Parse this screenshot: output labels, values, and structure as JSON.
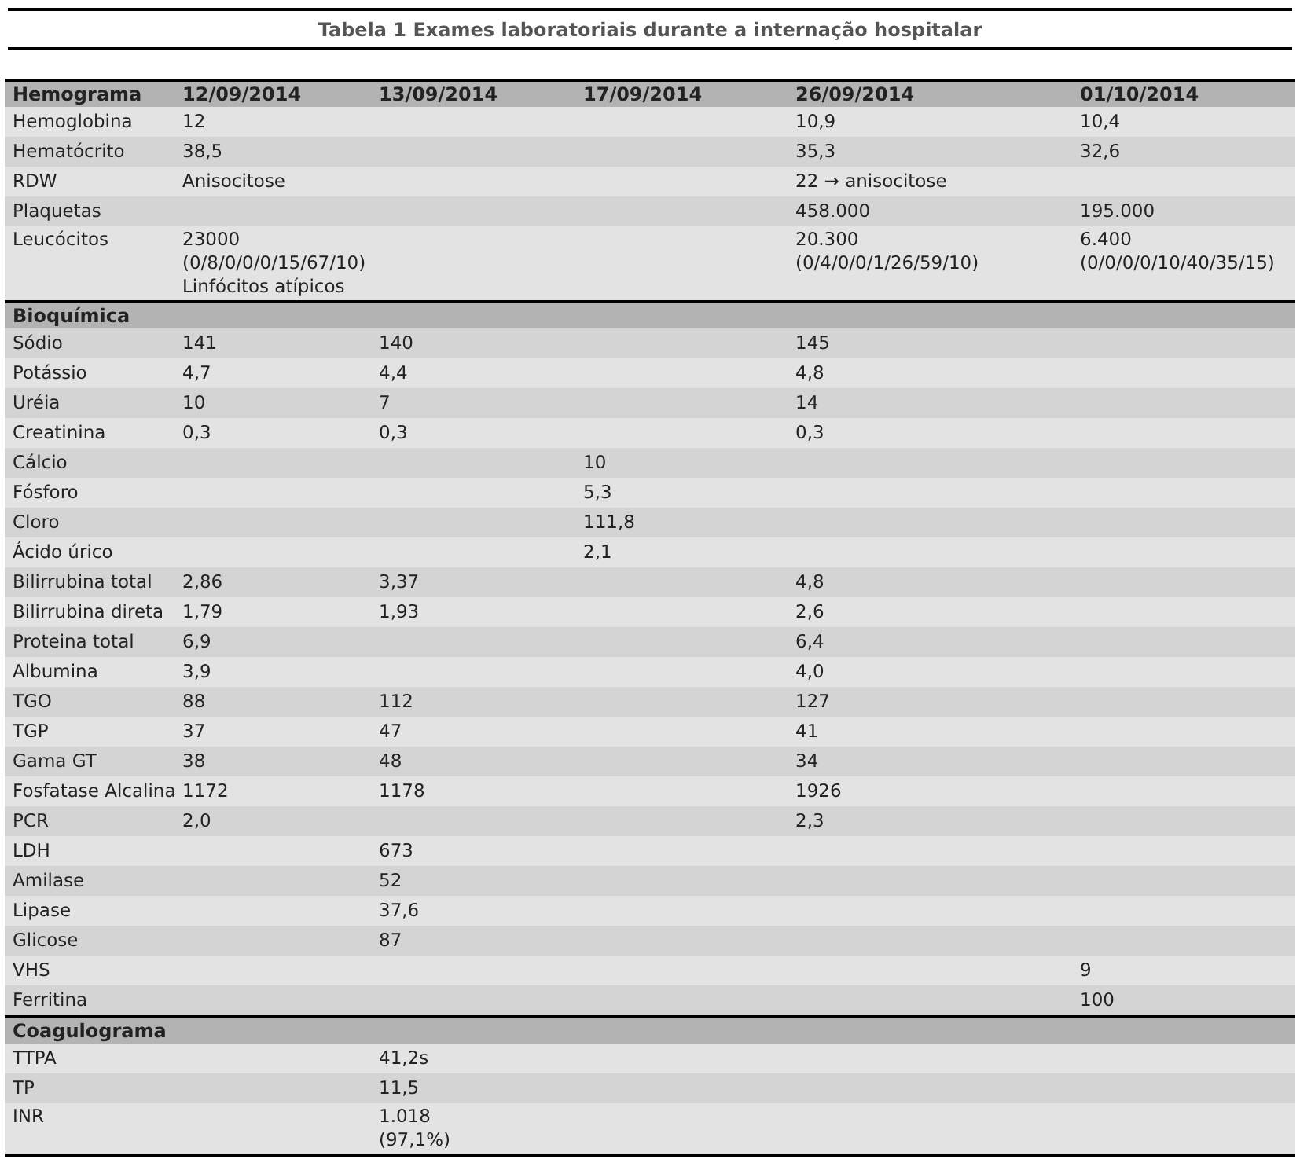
{
  "title": "Tabela 1  Exames laboratoriais durante a internação hospitalar",
  "sections": [
    {
      "title": "Hemograma",
      "columns": [
        "12/09/2014",
        "13/09/2014",
        "17/09/2014",
        "26/09/2014",
        "01/10/2014"
      ],
      "rows": [
        {
          "label": "Hemoglobina",
          "cells": [
            "12",
            null,
            null,
            "10,9",
            "10,4"
          ]
        },
        {
          "label": "Hematócrito",
          "cells": [
            "38,5",
            null,
            null,
            "35,3",
            "32,6"
          ]
        },
        {
          "label": "RDW",
          "cells": [
            "Anisocitose",
            null,
            null,
            "22 → anisocitose",
            null
          ]
        },
        {
          "label": "Plaquetas",
          "cells": [
            null,
            null,
            null,
            "458.000",
            "195.000"
          ]
        },
        {
          "label": "Leucócitos",
          "cells": [
            "23000\n(0/8/0/0/0/15/67/10)\nLinfócitos atípicos",
            null,
            null,
            "20.300\n(0/4/0/0/1/26/59/10)",
            "6.400\n(0/0/0/0/10/40/35/15)"
          ]
        }
      ]
    },
    {
      "title": "Bioquímica",
      "rows": [
        {
          "label": "Sódio",
          "cells": [
            "141",
            "140",
            null,
            "145",
            null
          ]
        },
        {
          "label": "Potássio",
          "cells": [
            "4,7",
            "4,4",
            null,
            "4,8",
            null
          ]
        },
        {
          "label": "Uréia",
          "cells": [
            "10",
            "7",
            null,
            "14",
            null
          ]
        },
        {
          "label": "Creatinina",
          "cells": [
            "0,3",
            "0,3",
            null,
            "0,3",
            null
          ]
        },
        {
          "label": "Cálcio",
          "cells": [
            null,
            null,
            "10",
            null,
            null
          ]
        },
        {
          "label": "Fósforo",
          "cells": [
            null,
            null,
            "5,3",
            null,
            null
          ]
        },
        {
          "label": "Cloro",
          "cells": [
            null,
            null,
            "111,8",
            null,
            null
          ]
        },
        {
          "label": "Ácido úrico",
          "cells": [
            null,
            null,
            "2,1",
            null,
            null
          ]
        },
        {
          "label": "Bilirrubina total",
          "cells": [
            "2,86",
            "3,37",
            null,
            "4,8",
            null
          ]
        },
        {
          "label": "Bilirrubina direta",
          "cells": [
            "1,79",
            "1,93",
            null,
            "2,6",
            null
          ]
        },
        {
          "label": "Proteina total",
          "cells": [
            "6,9",
            null,
            null,
            "6,4",
            null
          ]
        },
        {
          "label": "Albumina",
          "cells": [
            "3,9",
            null,
            null,
            "4,0",
            null
          ]
        },
        {
          "label": "TGO",
          "cells": [
            "88",
            "112",
            null,
            "127",
            null
          ]
        },
        {
          "label": "TGP",
          "cells": [
            "37",
            "47",
            null,
            "41",
            null
          ]
        },
        {
          "label": "Gama GT",
          "cells": [
            "38",
            "48",
            null,
            "34",
            null
          ]
        },
        {
          "label": "Fosfatase Alcalina",
          "cells": [
            "1172",
            "1178",
            null,
            "1926",
            null
          ]
        },
        {
          "label": "PCR",
          "cells": [
            "2,0",
            null,
            null,
            "2,3",
            null
          ]
        },
        {
          "label": "LDH",
          "cells": [
            null,
            "673",
            null,
            null,
            null
          ]
        },
        {
          "label": "Amilase",
          "cells": [
            null,
            "52",
            null,
            null,
            null
          ]
        },
        {
          "label": "Lipase",
          "cells": [
            null,
            "37,6",
            null,
            null,
            null
          ]
        },
        {
          "label": "Glicose",
          "cells": [
            null,
            "87",
            null,
            null,
            null
          ]
        },
        {
          "label": "VHS",
          "cells": [
            null,
            null,
            null,
            null,
            "9"
          ]
        },
        {
          "label": "Ferritina",
          "cells": [
            null,
            null,
            null,
            null,
            "100"
          ]
        }
      ]
    },
    {
      "title": "Coagulograma",
      "rows": [
        {
          "label": "TTPA",
          "cells": [
            null,
            "41,2s",
            null,
            null,
            null
          ]
        },
        {
          "label": "TP",
          "cells": [
            null,
            "11,5",
            null,
            null,
            null
          ]
        },
        {
          "label": "INR",
          "cells": [
            null,
            "1.018\n(97,1%)",
            null,
            null,
            null
          ]
        }
      ]
    }
  ]
}
